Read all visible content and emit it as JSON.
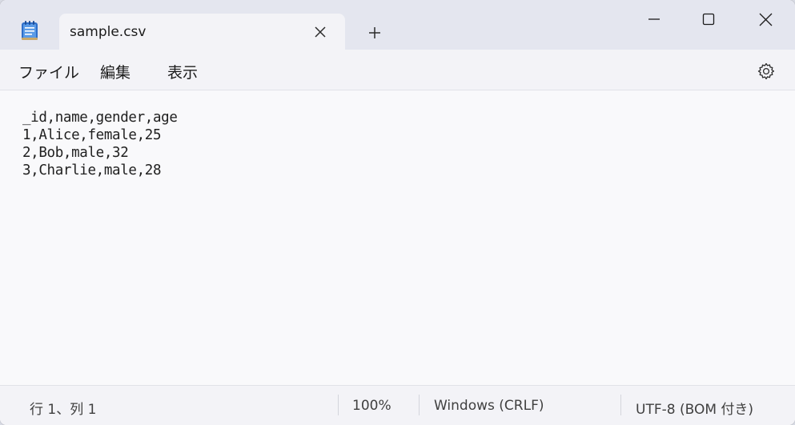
{
  "tab": {
    "title": "sample.csv",
    "close_icon": "close-icon",
    "new_tab_icon": "plus-icon"
  },
  "window_controls": {
    "minimize_icon": "minimize-icon",
    "maximize_icon": "maximize-icon",
    "close_icon": "close-icon"
  },
  "menu": {
    "items": [
      {
        "label": "ファイル"
      },
      {
        "label": "編集"
      },
      {
        "label": "表示"
      }
    ],
    "settings_icon": "gear-icon"
  },
  "editor": {
    "lines": [
      "_id,name,gender,age",
      "1,Alice,female,25",
      "2,Bob,male,32",
      "3,Charlie,male,28"
    ]
  },
  "statusbar": {
    "position": "行 1、列 1",
    "zoom": "100%",
    "line_ending": "Windows (CRLF)",
    "encoding": "UTF-8 (BOM 付き)"
  },
  "colors": {
    "titlebar": "#e4e6ef",
    "tab": "#f3f3f7",
    "editor_bg": "#f9f9fb",
    "app_icon_blue": "#2f6fc9"
  }
}
